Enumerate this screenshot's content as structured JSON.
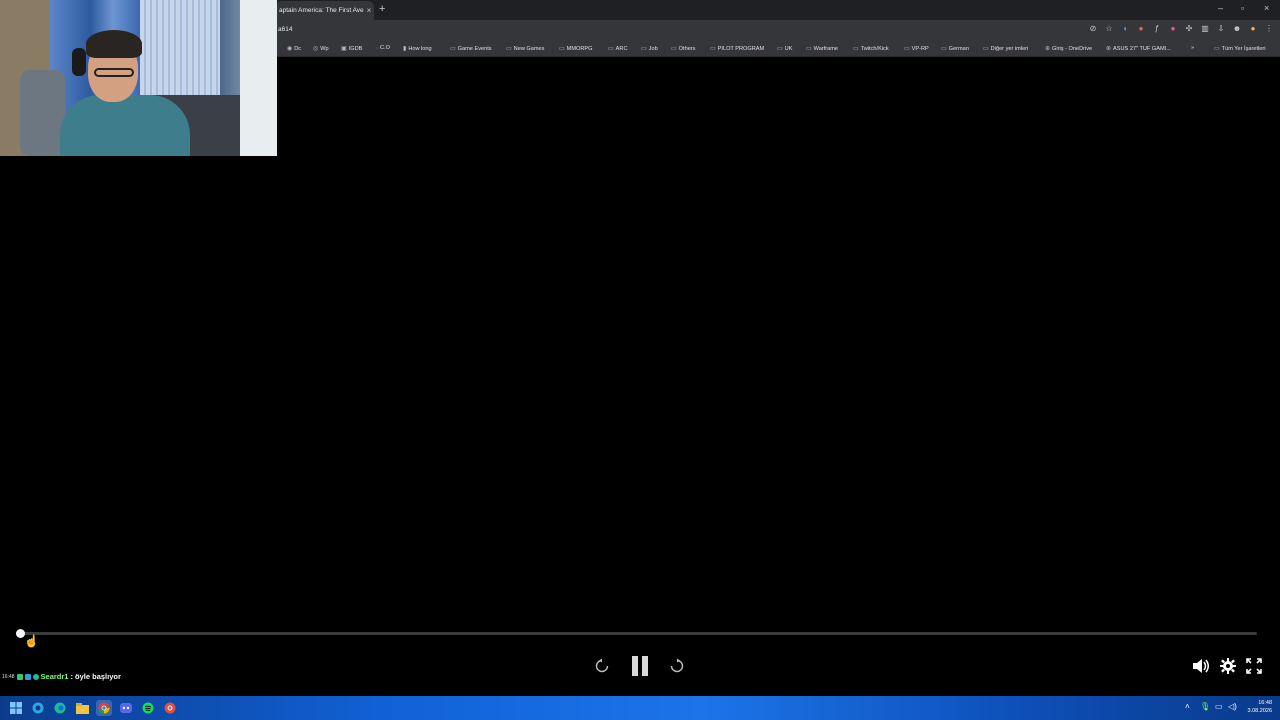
{
  "browser": {
    "tab_title": "aptain America: The First Ave",
    "tab_close": "×",
    "new_tab": "+",
    "window_controls": [
      "–",
      "▫",
      "×"
    ],
    "url": "a614",
    "bookmarks": [
      {
        "label": "Dc",
        "icon": "discord-icon"
      },
      {
        "label": "Wp",
        "icon": "whatsapp-icon"
      },
      {
        "label": "IGDB",
        "icon": "igdb-icon"
      },
      {
        "label": "C.O",
        "icon": "link-icon"
      },
      {
        "label": "How long",
        "icon": "bookmark-icon"
      },
      {
        "label": "Game Events",
        "icon": "folder-icon"
      },
      {
        "label": "New Games",
        "icon": "folder-icon"
      },
      {
        "label": "MMORPG",
        "icon": "folder-icon"
      },
      {
        "label": "ARC",
        "icon": "folder-icon"
      },
      {
        "label": "Job",
        "icon": "folder-icon"
      },
      {
        "label": "Others",
        "icon": "folder-icon"
      },
      {
        "label": "PILOT PROGRAM",
        "icon": "folder-icon"
      },
      {
        "label": "UK",
        "icon": "folder-icon"
      },
      {
        "label": "Warframe",
        "icon": "folder-icon"
      },
      {
        "label": "Twitch/Kick",
        "icon": "folder-icon"
      },
      {
        "label": "VP-RP",
        "icon": "folder-icon"
      },
      {
        "label": "German",
        "icon": "folder-icon"
      },
      {
        "label": "Diğer yer imleri",
        "icon": "folder-icon"
      },
      {
        "label": "Giriş - OneDrive",
        "icon": "globe-icon"
      },
      {
        "label": "ASUS 27\" TUF GAMI...",
        "icon": "globe-icon"
      }
    ],
    "bookmarks_overflow": "»",
    "all_bookmarks": "Tüm Yer İşaretleri"
  },
  "player": {
    "progress": 0.002
  },
  "chat": {
    "time": "16:48",
    "user": "Seardr1",
    "message": ": öyle başlıyor"
  },
  "taskbar": {
    "apps": [
      "windows-start-icon",
      "edge-icon",
      "chrome-icon",
      "file-explorer-icon",
      "chrome-active-icon",
      "discord-icon",
      "spotify-icon",
      "chrome-alt-icon"
    ],
    "time": "16:48",
    "date": "3.08.2026"
  },
  "colors": {
    "seek_played": "#e6e6e6",
    "chat_user": "#7dff6a",
    "taskbar": "#1161d6"
  }
}
